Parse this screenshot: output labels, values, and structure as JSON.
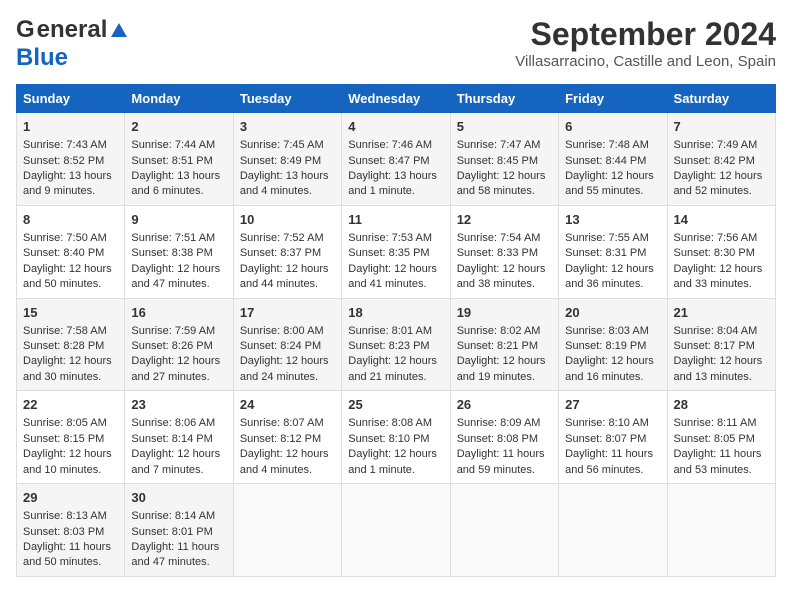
{
  "header": {
    "logo_general": "General",
    "logo_blue": "Blue",
    "title": "September 2024",
    "subtitle": "Villasarracino, Castille and Leon, Spain"
  },
  "calendar": {
    "days_of_week": [
      "Sunday",
      "Monday",
      "Tuesday",
      "Wednesday",
      "Thursday",
      "Friday",
      "Saturday"
    ],
    "weeks": [
      [
        {
          "day": "1",
          "sunrise": "Sunrise: 7:43 AM",
          "sunset": "Sunset: 8:52 PM",
          "daylight": "Daylight: 13 hours and 9 minutes."
        },
        {
          "day": "2",
          "sunrise": "Sunrise: 7:44 AM",
          "sunset": "Sunset: 8:51 PM",
          "daylight": "Daylight: 13 hours and 6 minutes."
        },
        {
          "day": "3",
          "sunrise": "Sunrise: 7:45 AM",
          "sunset": "Sunset: 8:49 PM",
          "daylight": "Daylight: 13 hours and 4 minutes."
        },
        {
          "day": "4",
          "sunrise": "Sunrise: 7:46 AM",
          "sunset": "Sunset: 8:47 PM",
          "daylight": "Daylight: 13 hours and 1 minute."
        },
        {
          "day": "5",
          "sunrise": "Sunrise: 7:47 AM",
          "sunset": "Sunset: 8:45 PM",
          "daylight": "Daylight: 12 hours and 58 minutes."
        },
        {
          "day": "6",
          "sunrise": "Sunrise: 7:48 AM",
          "sunset": "Sunset: 8:44 PM",
          "daylight": "Daylight: 12 hours and 55 minutes."
        },
        {
          "day": "7",
          "sunrise": "Sunrise: 7:49 AM",
          "sunset": "Sunset: 8:42 PM",
          "daylight": "Daylight: 12 hours and 52 minutes."
        }
      ],
      [
        {
          "day": "8",
          "sunrise": "Sunrise: 7:50 AM",
          "sunset": "Sunset: 8:40 PM",
          "daylight": "Daylight: 12 hours and 50 minutes."
        },
        {
          "day": "9",
          "sunrise": "Sunrise: 7:51 AM",
          "sunset": "Sunset: 8:38 PM",
          "daylight": "Daylight: 12 hours and 47 minutes."
        },
        {
          "day": "10",
          "sunrise": "Sunrise: 7:52 AM",
          "sunset": "Sunset: 8:37 PM",
          "daylight": "Daylight: 12 hours and 44 minutes."
        },
        {
          "day": "11",
          "sunrise": "Sunrise: 7:53 AM",
          "sunset": "Sunset: 8:35 PM",
          "daylight": "Daylight: 12 hours and 41 minutes."
        },
        {
          "day": "12",
          "sunrise": "Sunrise: 7:54 AM",
          "sunset": "Sunset: 8:33 PM",
          "daylight": "Daylight: 12 hours and 38 minutes."
        },
        {
          "day": "13",
          "sunrise": "Sunrise: 7:55 AM",
          "sunset": "Sunset: 8:31 PM",
          "daylight": "Daylight: 12 hours and 36 minutes."
        },
        {
          "day": "14",
          "sunrise": "Sunrise: 7:56 AM",
          "sunset": "Sunset: 8:30 PM",
          "daylight": "Daylight: 12 hours and 33 minutes."
        }
      ],
      [
        {
          "day": "15",
          "sunrise": "Sunrise: 7:58 AM",
          "sunset": "Sunset: 8:28 PM",
          "daylight": "Daylight: 12 hours and 30 minutes."
        },
        {
          "day": "16",
          "sunrise": "Sunrise: 7:59 AM",
          "sunset": "Sunset: 8:26 PM",
          "daylight": "Daylight: 12 hours and 27 minutes."
        },
        {
          "day": "17",
          "sunrise": "Sunrise: 8:00 AM",
          "sunset": "Sunset: 8:24 PM",
          "daylight": "Daylight: 12 hours and 24 minutes."
        },
        {
          "day": "18",
          "sunrise": "Sunrise: 8:01 AM",
          "sunset": "Sunset: 8:23 PM",
          "daylight": "Daylight: 12 hours and 21 minutes."
        },
        {
          "day": "19",
          "sunrise": "Sunrise: 8:02 AM",
          "sunset": "Sunset: 8:21 PM",
          "daylight": "Daylight: 12 hours and 19 minutes."
        },
        {
          "day": "20",
          "sunrise": "Sunrise: 8:03 AM",
          "sunset": "Sunset: 8:19 PM",
          "daylight": "Daylight: 12 hours and 16 minutes."
        },
        {
          "day": "21",
          "sunrise": "Sunrise: 8:04 AM",
          "sunset": "Sunset: 8:17 PM",
          "daylight": "Daylight: 12 hours and 13 minutes."
        }
      ],
      [
        {
          "day": "22",
          "sunrise": "Sunrise: 8:05 AM",
          "sunset": "Sunset: 8:15 PM",
          "daylight": "Daylight: 12 hours and 10 minutes."
        },
        {
          "day": "23",
          "sunrise": "Sunrise: 8:06 AM",
          "sunset": "Sunset: 8:14 PM",
          "daylight": "Daylight: 12 hours and 7 minutes."
        },
        {
          "day": "24",
          "sunrise": "Sunrise: 8:07 AM",
          "sunset": "Sunset: 8:12 PM",
          "daylight": "Daylight: 12 hours and 4 minutes."
        },
        {
          "day": "25",
          "sunrise": "Sunrise: 8:08 AM",
          "sunset": "Sunset: 8:10 PM",
          "daylight": "Daylight: 12 hours and 1 minute."
        },
        {
          "day": "26",
          "sunrise": "Sunrise: 8:09 AM",
          "sunset": "Sunset: 8:08 PM",
          "daylight": "Daylight: 11 hours and 59 minutes."
        },
        {
          "day": "27",
          "sunrise": "Sunrise: 8:10 AM",
          "sunset": "Sunset: 8:07 PM",
          "daylight": "Daylight: 11 hours and 56 minutes."
        },
        {
          "day": "28",
          "sunrise": "Sunrise: 8:11 AM",
          "sunset": "Sunset: 8:05 PM",
          "daylight": "Daylight: 11 hours and 53 minutes."
        }
      ],
      [
        {
          "day": "29",
          "sunrise": "Sunrise: 8:13 AM",
          "sunset": "Sunset: 8:03 PM",
          "daylight": "Daylight: 11 hours and 50 minutes."
        },
        {
          "day": "30",
          "sunrise": "Sunrise: 8:14 AM",
          "sunset": "Sunset: 8:01 PM",
          "daylight": "Daylight: 11 hours and 47 minutes."
        },
        {
          "day": "",
          "sunrise": "",
          "sunset": "",
          "daylight": ""
        },
        {
          "day": "",
          "sunrise": "",
          "sunset": "",
          "daylight": ""
        },
        {
          "day": "",
          "sunrise": "",
          "sunset": "",
          "daylight": ""
        },
        {
          "day": "",
          "sunrise": "",
          "sunset": "",
          "daylight": ""
        },
        {
          "day": "",
          "sunrise": "",
          "sunset": "",
          "daylight": ""
        }
      ]
    ]
  }
}
